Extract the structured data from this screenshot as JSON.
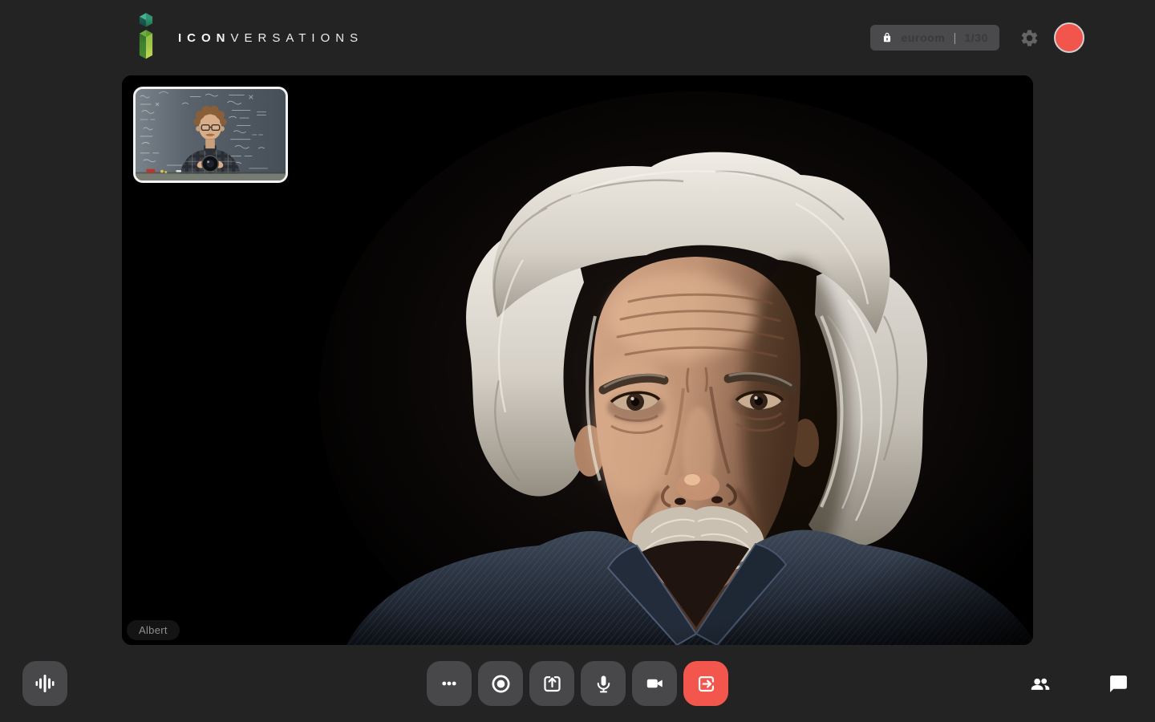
{
  "brand": {
    "name_bold": "ICON",
    "name_light": "VERSATIONS"
  },
  "header": {
    "room": {
      "name": "euroom",
      "divider": "|",
      "capacity": "1/30"
    }
  },
  "stage": {
    "participant_label": "Albert"
  },
  "controls": {
    "left": [
      {
        "id": "audio-levels",
        "icon": "graphic-eq-icon"
      }
    ],
    "center": [
      {
        "id": "more-options",
        "icon": "ellipsis-icon"
      },
      {
        "id": "record",
        "icon": "record-circle-icon"
      },
      {
        "id": "share-screen",
        "icon": "present-arrow-icon"
      },
      {
        "id": "microphone",
        "icon": "mic-icon"
      },
      {
        "id": "camera",
        "icon": "videocam-icon"
      },
      {
        "id": "leave-call",
        "icon": "exit-icon"
      }
    ],
    "right": [
      {
        "id": "participants",
        "icon": "people-icon"
      },
      {
        "id": "chat",
        "icon": "chat-bubble-icon"
      }
    ]
  },
  "colors": {
    "page_bg": "#232323",
    "button_bg": "#48484a",
    "pill_bg": "#4a4a4c",
    "accent_red": "#f2564c",
    "avatar_red": "#f2554b",
    "logo_green": "#6fae3c",
    "logo_teal": "#3fae8e",
    "name_tag_text": "#8f8f8f"
  }
}
